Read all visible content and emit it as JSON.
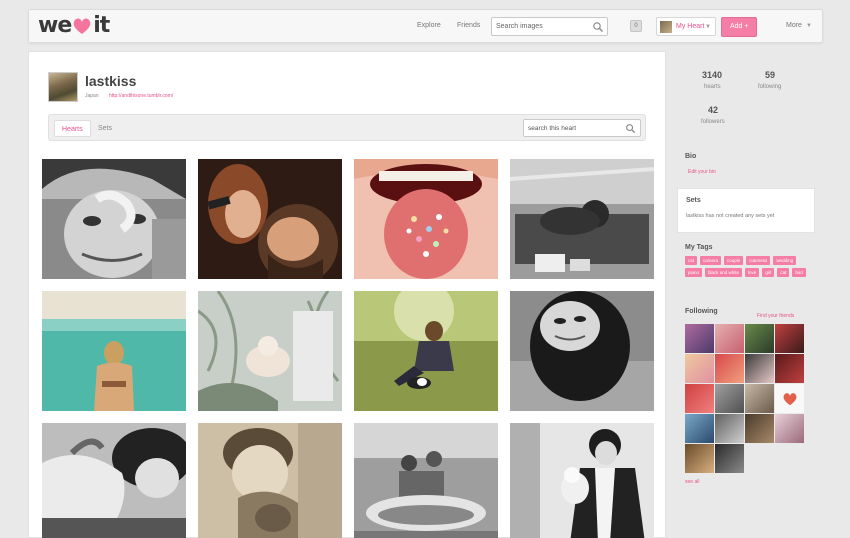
{
  "header": {
    "logo_left": "we",
    "logo_right": "it",
    "nav": [
      "Explore",
      "Friends"
    ],
    "search_placeholder": "Search images",
    "notification_count": "0",
    "my_heart": "My Heart",
    "add": "Add +",
    "more": "More"
  },
  "profile": {
    "name": "lastkiss",
    "location": "Japan",
    "website": "http://andthisone.tumblr.com/"
  },
  "tabs": {
    "hearts": "Hearts",
    "sets": "Sets",
    "search_placeholder": "search this heart"
  },
  "images": [
    {
      "subject": "woman with hat heart hand",
      "tone": "bw"
    },
    {
      "subject": "couple singing",
      "tone": "warm"
    },
    {
      "subject": "tongue with sprinkles",
      "tone": "pink"
    },
    {
      "subject": "couple on sofa",
      "tone": "bw"
    },
    {
      "subject": "woman in sea",
      "tone": "teal"
    },
    {
      "subject": "cat in leaves",
      "tone": "pale"
    },
    {
      "subject": "girl sitting on grass with dog",
      "tone": "olive"
    },
    {
      "subject": "upside down face",
      "tone": "bw"
    },
    {
      "subject": "holding hands",
      "tone": "bw"
    },
    {
      "subject": "man with cat",
      "tone": "sepia"
    },
    {
      "subject": "kids in boat",
      "tone": "bw"
    },
    {
      "subject": "man holding baby",
      "tone": "bw"
    }
  ],
  "sidebar": {
    "hearts_count": "3140",
    "hearts_label": "hearts",
    "following_count": "59",
    "following_label": "following",
    "followers_count": "42",
    "followers_label": "followers",
    "bio_heading": "Bio",
    "edit_bio": "Edit your bio",
    "sets_heading": "Sets",
    "sets_text": "lastkiss has not created any sets yet",
    "tags_heading": "My Tags",
    "tags": [
      "cat",
      "camera",
      "couple",
      "cuteness",
      "wedding",
      "piano",
      "black and white",
      "love",
      "girl",
      "cat",
      "bird"
    ],
    "following_heading": "Following",
    "find_friends": "Find your friends",
    "see_all": "see all"
  },
  "colors": {
    "accent": "#f47ea6",
    "link": "#e8528a"
  }
}
